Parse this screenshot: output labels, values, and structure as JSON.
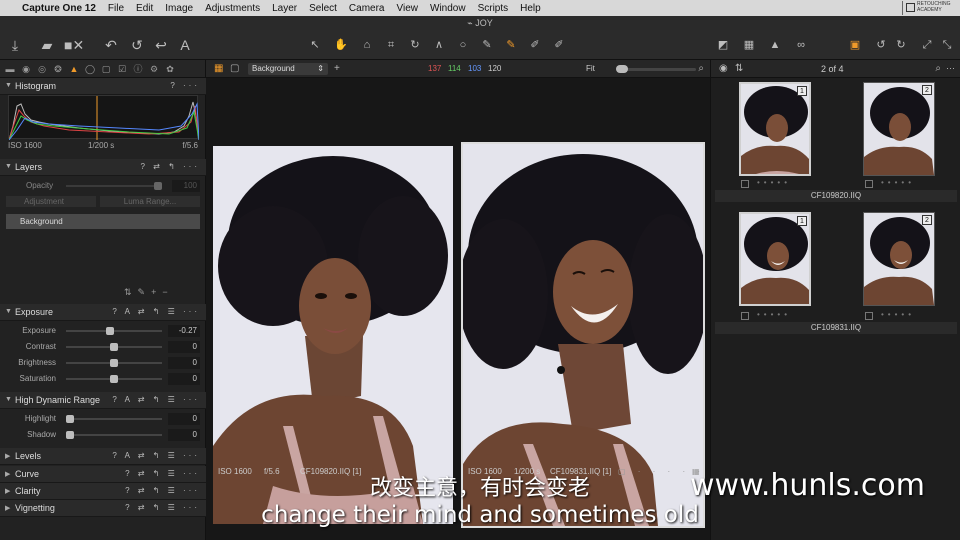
{
  "menubar": {
    "app_name": "Capture One 12",
    "items": [
      "File",
      "Edit",
      "Image",
      "Adjustments",
      "Layer",
      "Select",
      "Camera",
      "View",
      "Window",
      "Scripts",
      "Help"
    ],
    "logo_line1": "RETOUCHING",
    "logo_line2": "ACADEMY"
  },
  "window": {
    "title": "JOY"
  },
  "viewer": {
    "preset": "Background",
    "rgb": {
      "r": "137",
      "g": "114",
      "b": "103",
      "l": "120"
    },
    "zoom": "Fit",
    "photos": [
      {
        "iso": "ISO 1600",
        "aperture": "f/5.6",
        "filename": "CF109820.IIQ [1]"
      },
      {
        "iso": "ISO 1600",
        "shutter": "1/200 s",
        "filename": "CF109831.IIQ [1]"
      }
    ]
  },
  "histogram": {
    "title": "Histogram",
    "iso": "ISO 1600",
    "shutter": "1/200 s",
    "aperture": "f/5.6"
  },
  "layers": {
    "title": "Layers",
    "opacity_label": "Opacity",
    "opacity_value": "100",
    "adjustment_label": "Adjustment",
    "luma_label": "Luma Range...",
    "layer_name": "Background"
  },
  "exposure": {
    "title": "Exposure",
    "sliders": [
      {
        "label": "Exposure",
        "value": "-0.27"
      },
      {
        "label": "Contrast",
        "value": "0"
      },
      {
        "label": "Brightness",
        "value": "0"
      },
      {
        "label": "Saturation",
        "value": "0"
      }
    ]
  },
  "hdr": {
    "title": "High Dynamic Range",
    "sliders": [
      {
        "label": "Highlight",
        "value": "0"
      },
      {
        "label": "Shadow",
        "value": "0"
      }
    ]
  },
  "collapsed_tools": [
    "Levels",
    "Curve",
    "Clarity",
    "Vignetting"
  ],
  "browser": {
    "count": "2 of 4",
    "rows": [
      {
        "name": "CF109820.IIQ",
        "badges": [
          "1",
          "2"
        ]
      },
      {
        "name": "CF109831.IIQ",
        "badges": [
          "1",
          "2"
        ]
      }
    ]
  },
  "overlay": {
    "subtitle_cn": "改变主意，有时会变老",
    "subtitle_en": "change their mind and sometimes old",
    "watermark": "www.hunls.com"
  },
  "colors": {
    "accent": "#f09a2a",
    "panel": "#222222"
  }
}
